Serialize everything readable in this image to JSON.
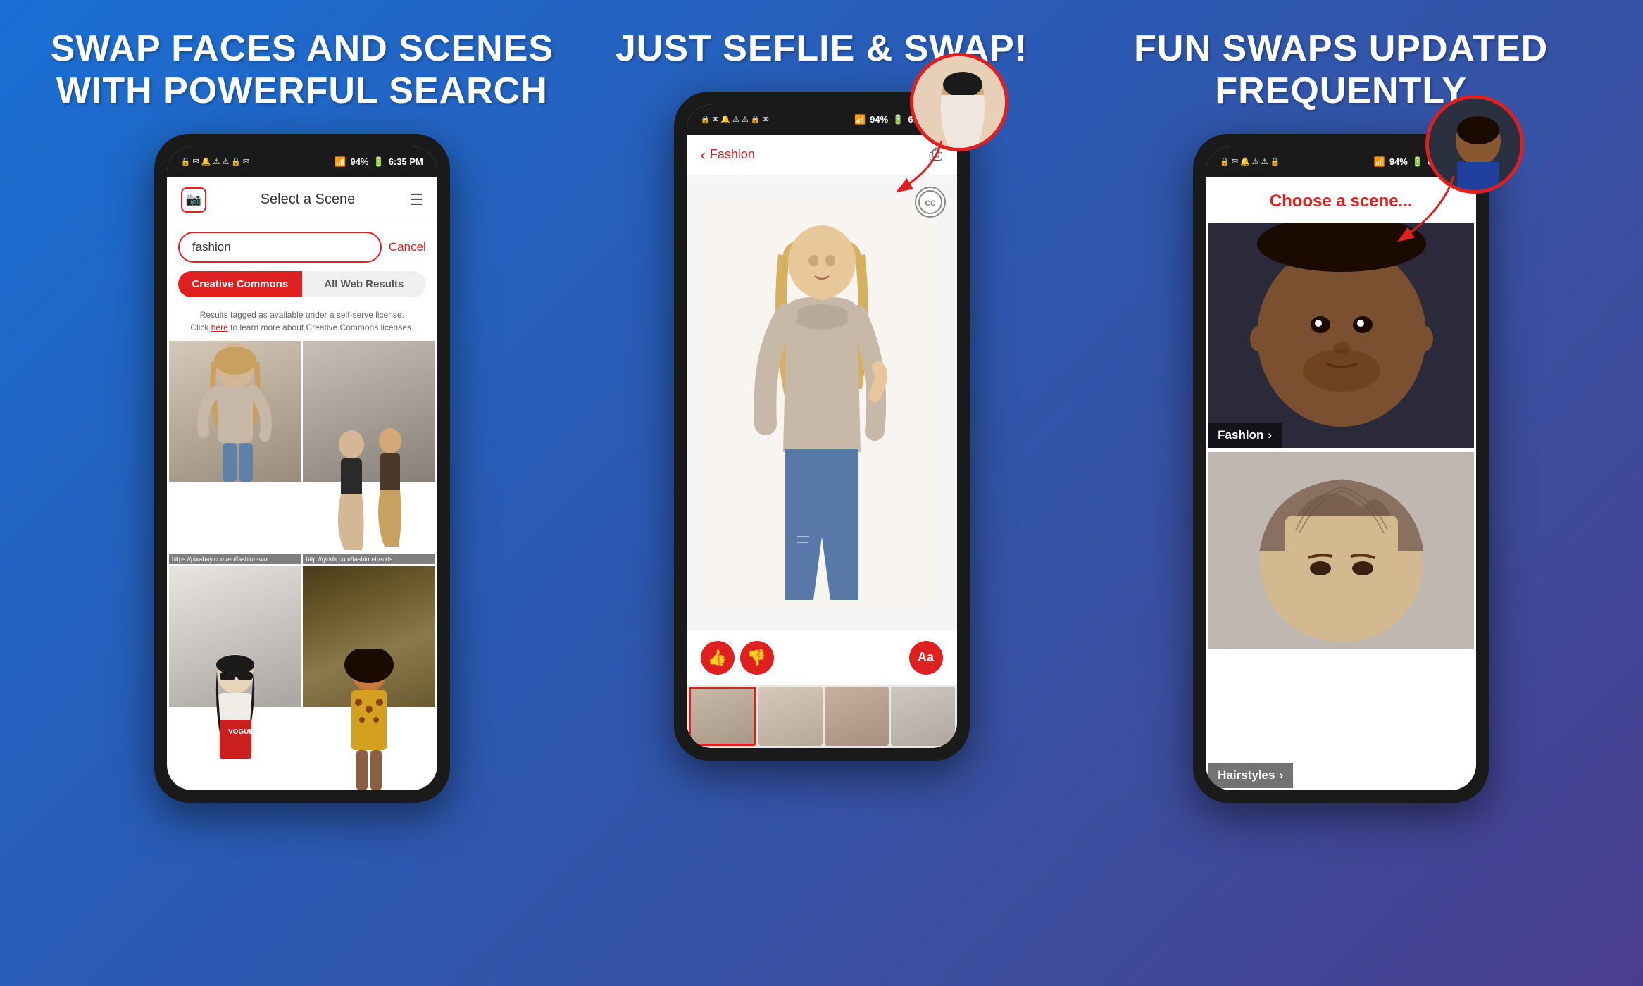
{
  "sections": [
    {
      "id": "section1",
      "title": "SWAP FACES AND SCENES\nWITH POWERFUL SEARCH",
      "phone": {
        "statusBar": {
          "battery": "94%",
          "time": "6:35 PM"
        },
        "header": {
          "title": "Select a Scene",
          "cameraLabel": "camera",
          "menuLabel": "menu"
        },
        "search": {
          "value": "fashion",
          "placeholder": "fashion",
          "cancelLabel": "Cancel"
        },
        "toggle": {
          "option1": "Creative Commons",
          "option2": "All Web Results",
          "activeIndex": 0
        },
        "licenseText": "Results tagged as available under a self-serve license.",
        "licenseLink": "here",
        "licenseText2": "to learn more about Creative Commons licenses.",
        "images": [
          {
            "url": "https://pixabay.com/en/fashion-wor",
            "position": "top-left"
          },
          {
            "url": "http://girldir.com/fashion-trends",
            "position": "top-right"
          },
          {
            "url": "",
            "position": "bottom-left"
          },
          {
            "url": "",
            "position": "bottom-right"
          }
        ]
      }
    },
    {
      "id": "section2",
      "title": "JUST SEFLIE & SWAP!",
      "phone": {
        "statusBar": {
          "battery": "94%",
          "time": "6:35 PM"
        },
        "header": {
          "backLabel": "Fashion",
          "backIcon": "‹",
          "shareIcon": "share"
        },
        "ccBadge": "CC",
        "actionBar": {
          "thumbUpLabel": "👍",
          "thumbDownLabel": "👎",
          "aaLabel": "Aa"
        },
        "thumbnails": [
          "selected",
          "normal",
          "normal",
          "normal"
        ]
      }
    },
    {
      "id": "section3",
      "title": "FUN SWAPS UPDATED\nFREQUENTLY",
      "phone": {
        "statusBar": {
          "battery": "94%",
          "time": "6:35 PM"
        },
        "chooseText": "Choose a scene...",
        "scenes": [
          {
            "label": "Fashion",
            "arrow": "›"
          },
          {
            "label": "Hairstyles",
            "arrow": "›"
          }
        ]
      }
    }
  ],
  "colors": {
    "primary": "#e02020",
    "background": "#2060c0",
    "phoneFrame": "#1a1a1a",
    "white": "#ffffff"
  }
}
